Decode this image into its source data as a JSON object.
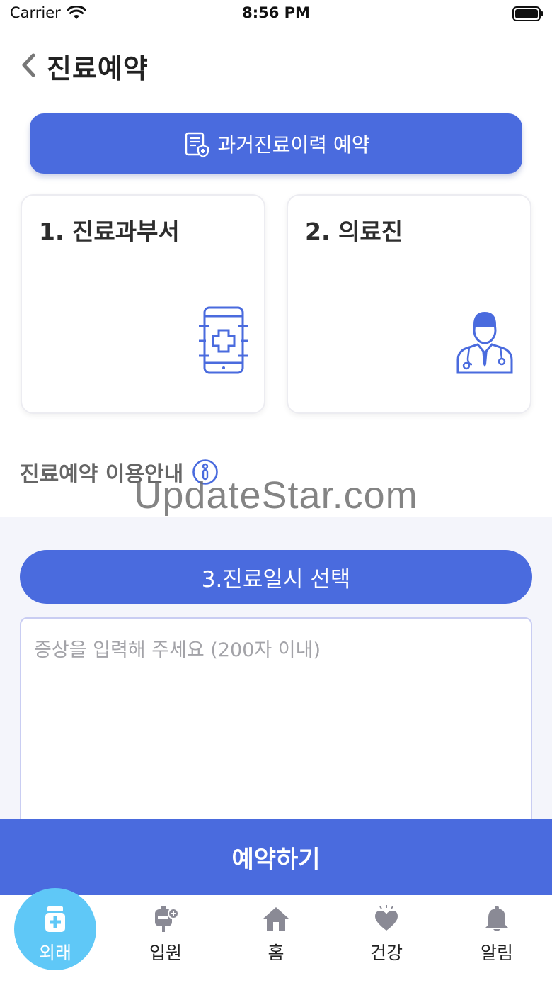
{
  "status_bar": {
    "carrier": "Carrier",
    "time": "8:56 PM"
  },
  "header": {
    "title": "진료예약"
  },
  "history_button": {
    "label": "과거진료이력 예약",
    "icon": "document-shield-icon"
  },
  "cards": [
    {
      "label": "1. 진료과부서",
      "icon": "mobile-medical-cross-icon"
    },
    {
      "label": "2. 의료진",
      "icon": "doctor-icon"
    }
  ],
  "guide": {
    "label": "진료예약 이용안내",
    "icon": "info-icon"
  },
  "watermark": "UpdateStar.com",
  "date_button": {
    "label": "3.진료일시 선택"
  },
  "symptom_input": {
    "value": "",
    "placeholder": "증상을 입력해 주세요 (200자 이내)"
  },
  "reserve_button": {
    "label": "예약하기"
  },
  "tab_bar": {
    "items": [
      {
        "label": "외래",
        "icon": "medicine-bottle-icon",
        "active": true
      },
      {
        "label": "입원",
        "icon": "iv-bag-icon",
        "active": false
      },
      {
        "label": "홈",
        "icon": "home-icon",
        "active": false
      },
      {
        "label": "건강",
        "icon": "heart-icon",
        "active": false
      },
      {
        "label": "알림",
        "icon": "bell-icon",
        "active": false
      }
    ]
  },
  "colors": {
    "primary": "#4a6bde",
    "active_tab": "#5fc8f7",
    "lower_background": "#f4f5fb",
    "icon_gray": "#8a8a95"
  }
}
